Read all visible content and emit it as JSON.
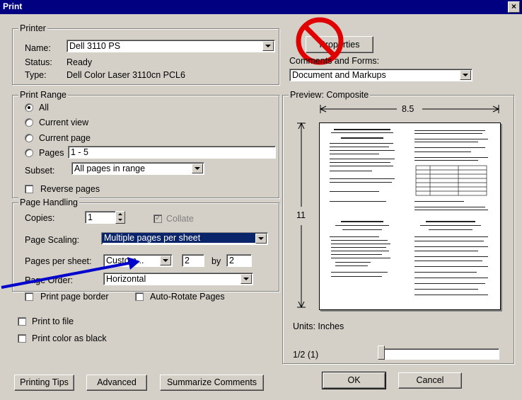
{
  "window": {
    "title": "Print",
    "close_glyph": "×"
  },
  "printer": {
    "legend": "Printer",
    "name_label": "Name:",
    "name_value": "Dell 3110 PS",
    "status_label": "Status:",
    "status_value": "Ready",
    "type_label": "Type:",
    "type_value": "Dell Color Laser 3110cn PCL6",
    "properties_label": "Properties",
    "comments_label": "Comments and Forms:",
    "comments_value": "Document and Markups"
  },
  "print_range": {
    "legend": "Print Range",
    "all": "All",
    "current_view": "Current view",
    "current_page": "Current page",
    "pages": "Pages",
    "pages_value": "1 - 5",
    "subset_label": "Subset:",
    "subset_value": "All pages in range",
    "reverse": "Reverse pages"
  },
  "page_handling": {
    "legend": "Page Handling",
    "copies_label": "Copies:",
    "copies_value": "1",
    "collate": "Collate",
    "scaling_label": "Page Scaling:",
    "scaling_value": "Multiple pages per sheet",
    "pps_label": "Pages per sheet:",
    "pps_value": "Custom...",
    "pps_x": "2",
    "by_label": "by",
    "pps_y": "2",
    "order_label": "Page Order:",
    "order_value": "Horizontal",
    "print_border": "Print page border",
    "auto_rotate": "Auto-Rotate Pages"
  },
  "options": {
    "print_to_file": "Print to file",
    "print_black": "Print color as black"
  },
  "preview": {
    "legend": "Preview: Composite",
    "width": "8.5",
    "height": "11",
    "units": "Units: Inches",
    "page_count": "1/2 (1)"
  },
  "buttons": {
    "tips": "Printing Tips",
    "advanced": "Advanced",
    "summarize": "Summarize Comments",
    "ok": "OK",
    "cancel": "Cancel"
  },
  "annotation": {
    "no_sign_color": "#e00000",
    "arrow_color": "#0000cc"
  }
}
